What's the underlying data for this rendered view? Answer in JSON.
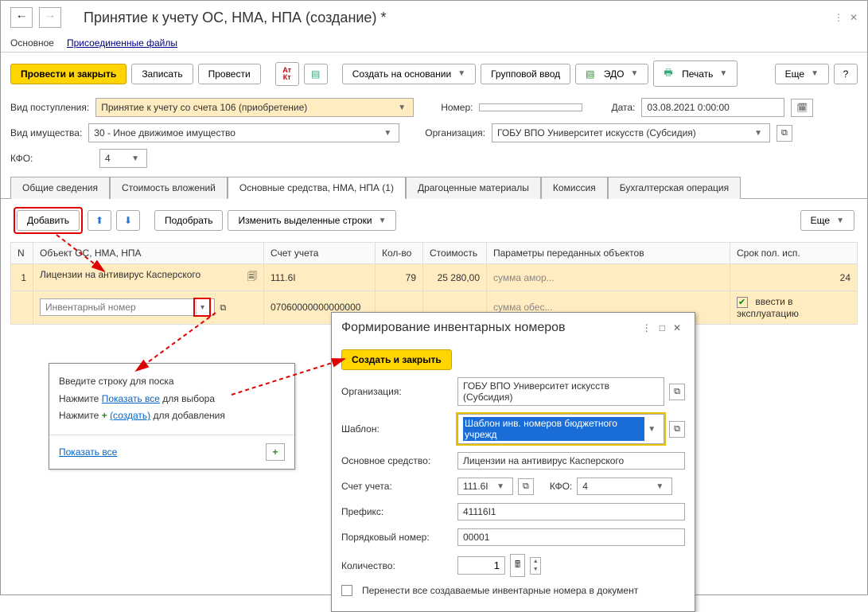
{
  "title": "Принятие к учету ОС, НМА, НПА (создание) *",
  "top_tabs": {
    "t1": "Основное",
    "t2": "Присоединенные файлы"
  },
  "toolbar": {
    "post_close": "Провести и закрыть",
    "save": "Записать",
    "post": "Провести",
    "create_based": "Создать на основании",
    "group_input": "Групповой ввод",
    "edo": "ЭДО",
    "print": "Печать",
    "more": "Еще"
  },
  "form": {
    "receipt_type_lbl": "Вид поступления:",
    "receipt_type_val": "Принятие к учету со счета 106 (приобретение)",
    "number_lbl": "Номер:",
    "number_val": "",
    "date_lbl": "Дата:",
    "date_val": "03.08.2021 0:00:00",
    "prop_kind_lbl": "Вид имущества:",
    "prop_kind_val": "30 - Иное движимое имущество",
    "org_lbl": "Организация:",
    "org_val": "ГОБУ ВПО Университет искусств (Субсидия)",
    "kfo_lbl": "КФО:",
    "kfo_val": "4"
  },
  "main_tabs": {
    "t1": "Общие сведения",
    "t2": "Стоимость вложений",
    "t3": "Основные средства, НМА, НПА (1)",
    "t4": "Драгоценные материалы",
    "t5": "Комиссия",
    "t6": "Бухгалтерская операция"
  },
  "subtoolbar": {
    "add": "Добавить",
    "pick": "Подобрать",
    "edit_selected": "Изменить выделенные строки",
    "more": "Еще"
  },
  "table": {
    "hdr": {
      "n": "N",
      "obj": "Объект ОС, НМА, НПА",
      "acct": "Счет учета",
      "qty": "Кол-во",
      "cost": "Стоимость",
      "params": "Параметры переданных объектов",
      "life": "Срок пол. исп."
    },
    "row1": {
      "n": "1",
      "obj": "Лицензии на антивирус Касперского",
      "acct": "111.6I",
      "acct2": "07060000000000000",
      "qty": "79",
      "cost": "25 280,00",
      "param1": "сумма амор...",
      "param2": "сумма обес...",
      "life": "24",
      "checkbox_lbl": "ввести в эксплуатацию",
      "inv_placeholder": "Инвентарный номер"
    }
  },
  "search_popup": {
    "line1_pre": "Введите строку для по",
    "line1_post": "ска",
    "line2_pre": "Нажмите ",
    "line2_link": "Показать все",
    "line2_post": " для выбора",
    "line3_pre": "Нажмите ",
    "line3_link": "(создать)",
    "line3_post": " для добавления",
    "show_all": "Показать все"
  },
  "dialog": {
    "title": "Формирование инвентарных номеров",
    "create_close": "Создать и закрыть",
    "org_lbl": "Организация:",
    "org_val": "ГОБУ ВПО Университет искусств (Субсидия)",
    "tmpl_lbl": "Шаблон:",
    "tmpl_val": "Шаблон инв. номеров бюджетного учрежд",
    "asset_lbl": "Основное средство:",
    "asset_val": "Лицензии на антивирус Касперского",
    "acct_lbl": "Счет учета:",
    "acct_val": "111.6I",
    "kfo_lbl": "КФО:",
    "kfo_val": "4",
    "prefix_lbl": "Префикс:",
    "prefix_val": "41116I1",
    "seq_lbl": "Порядковый номер:",
    "seq_val": "00001",
    "qty_lbl": "Количество:",
    "qty_val": "1",
    "transfer_lbl": "Перенести все создаваемые инвентарные номера в документ"
  }
}
